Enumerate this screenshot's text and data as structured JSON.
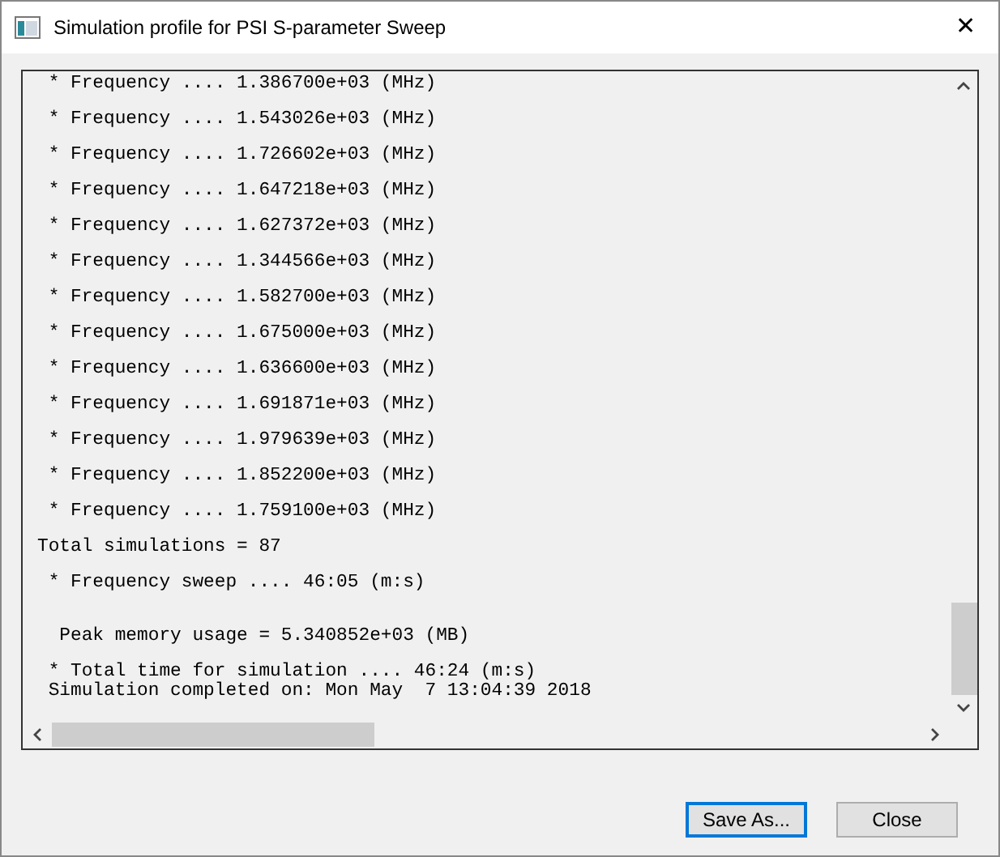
{
  "window": {
    "title": "Simulation profile for PSI S-parameter Sweep",
    "close": "✕"
  },
  "log": {
    "lines": [
      {
        "kind": "row",
        "text": " * Frequency .... 1.386700e+03 (MHz)"
      },
      {
        "kind": "row",
        "text": " * Frequency .... 1.543026e+03 (MHz)"
      },
      {
        "kind": "row",
        "text": " * Frequency .... 1.726602e+03 (MHz)"
      },
      {
        "kind": "row",
        "text": " * Frequency .... 1.647218e+03 (MHz)"
      },
      {
        "kind": "row",
        "text": " * Frequency .... 1.627372e+03 (MHz)"
      },
      {
        "kind": "row",
        "text": " * Frequency .... 1.344566e+03 (MHz)"
      },
      {
        "kind": "row",
        "text": " * Frequency .... 1.582700e+03 (MHz)"
      },
      {
        "kind": "row",
        "text": " * Frequency .... 1.675000e+03 (MHz)"
      },
      {
        "kind": "row",
        "text": " * Frequency .... 1.636600e+03 (MHz)"
      },
      {
        "kind": "row",
        "text": " * Frequency .... 1.691871e+03 (MHz)"
      },
      {
        "kind": "row",
        "text": " * Frequency .... 1.979639e+03 (MHz)"
      },
      {
        "kind": "row",
        "text": " * Frequency .... 1.852200e+03 (MHz)"
      },
      {
        "kind": "row",
        "text": " * Frequency .... 1.759100e+03 (MHz)"
      },
      {
        "kind": "row",
        "text": "Total simulations = 87"
      },
      {
        "kind": "row",
        "text": " * Frequency sweep .... 46:05 (m:s)"
      },
      {
        "kind": "spaced_row",
        "text": "  Peak memory usage = 5.340852e+03 (MB)"
      },
      {
        "kind": "tight_row",
        "text": " * Total time for simulation .... 46:24 (m:s)"
      },
      {
        "kind": "continued_row",
        "text": " Simulation completed on: Mon May  7 13:04:39 2018"
      }
    ]
  },
  "buttons": [
    {
      "label": "Save As...",
      "selected": true
    },
    {
      "label": "Close",
      "selected": false
    }
  ]
}
